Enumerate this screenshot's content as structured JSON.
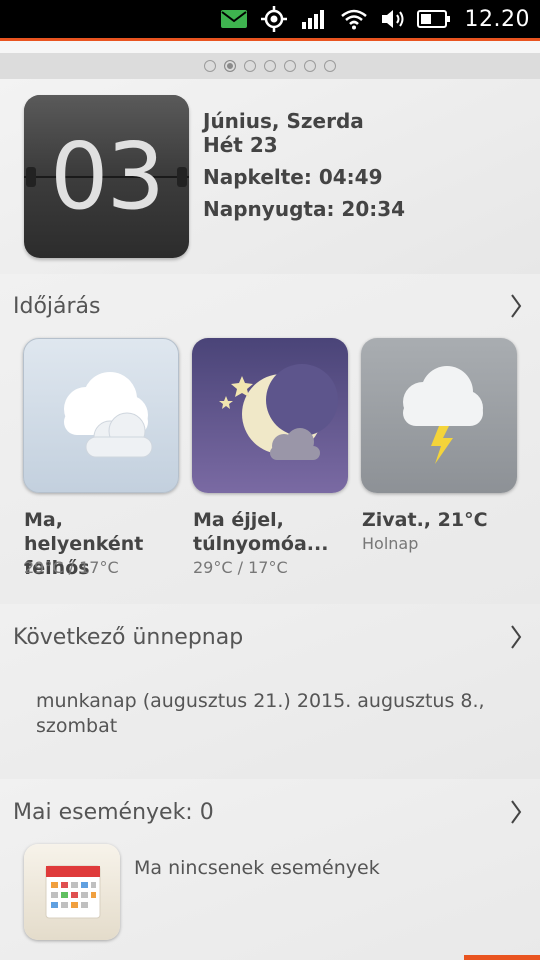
{
  "status_bar": {
    "time": "12.20",
    "icons": [
      "message-icon",
      "location-icon",
      "signal-icon",
      "wifi-icon",
      "volume-icon",
      "battery-icon"
    ]
  },
  "pager": {
    "count": 7,
    "active_index": 1
  },
  "date": {
    "day": "03",
    "line1": "Június, Szerda",
    "line2": "Hét 23",
    "sunrise": "Napkelte: 04:49",
    "sunset": "Napnyugta: 20:34"
  },
  "weather": {
    "title": "Időjárás",
    "items": [
      {
        "icon": "cloudy-icon",
        "label_line1": "Ma, helyenként",
        "label_line2": "felhős",
        "sub": "29°C / 17°C"
      },
      {
        "icon": "night-cloudy-icon",
        "label_line1": "Ma éjjel,",
        "label_line2": "túlnyomóa...",
        "sub": "29°C / 17°C"
      },
      {
        "icon": "thunderstorm-icon",
        "label_line1": "Zivat., 21°C",
        "label_line2": "",
        "sub": "Holnap"
      }
    ]
  },
  "holiday": {
    "title": "Következő ünnepnap",
    "text": "munkanap (augusztus 21.) 2015. augusztus 8., szombat"
  },
  "events": {
    "title": "Mai események: 0",
    "empty_text": "Ma nincsenek események"
  },
  "colors": {
    "accent": "#e95420",
    "statusbar": "#000000"
  }
}
